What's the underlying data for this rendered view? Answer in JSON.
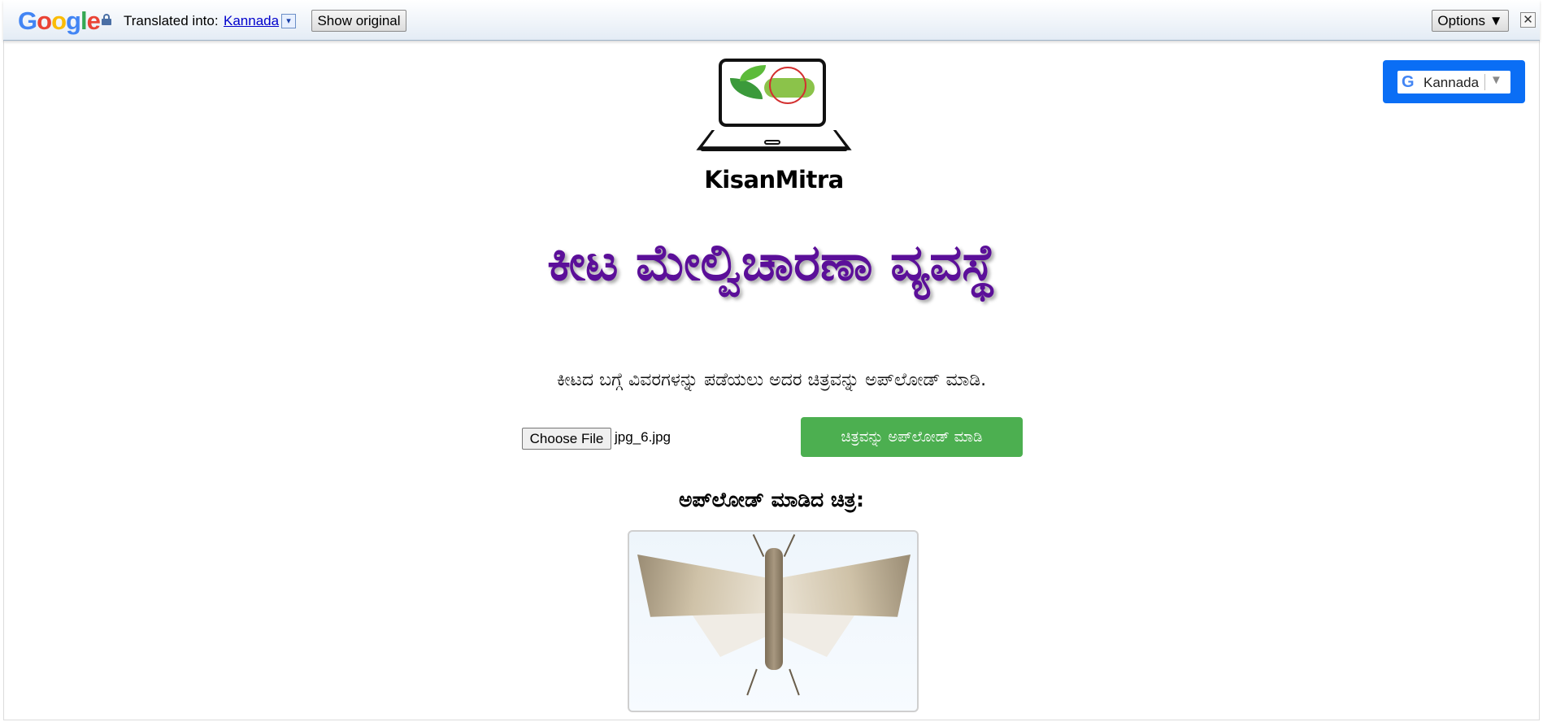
{
  "translate_bar": {
    "google_letters": [
      "G",
      "o",
      "o",
      "g",
      "l",
      "e"
    ],
    "translated_into": "Translated into:",
    "language": "Kannada",
    "dropdown_glyph": "▾",
    "show_original": "Show original",
    "options": "Options ▼",
    "close": "✕"
  },
  "language_widget": {
    "google_glyph": "G",
    "language": "Kannada",
    "arrow": "▼"
  },
  "logo": {
    "brand": "KisanMitra"
  },
  "main": {
    "title": "ಕೀಟ ಮೇಲ್ವಿಚಾರಣಾ ವ್ಯವಸ್ಥೆ",
    "subtitle": "ಕೀಟದ ಬಗ್ಗೆ ವಿವರಗಳನ್ನು ಪಡೆಯಲು ಅದರ ಚಿತ್ರವನ್ನು ಅಪ್‌ಲೋಡ್ ಮಾಡಿ.",
    "choose_file": "Choose File",
    "file_name": "jpg_6.jpg",
    "upload_button": "ಚಿತ್ರವನ್ನು ಅಪ್‌ಲೋಡ್ ಮಾಡಿ",
    "uploaded_heading": "ಅಪ್‌ಲೋಡ್ ಮಾಡಿದ ಚಿತ್ರ:"
  },
  "colors": {
    "title": "#5b0f99",
    "upload_button": "#4caf50",
    "widget": "#0a6ef5",
    "link": "#0000cc"
  }
}
